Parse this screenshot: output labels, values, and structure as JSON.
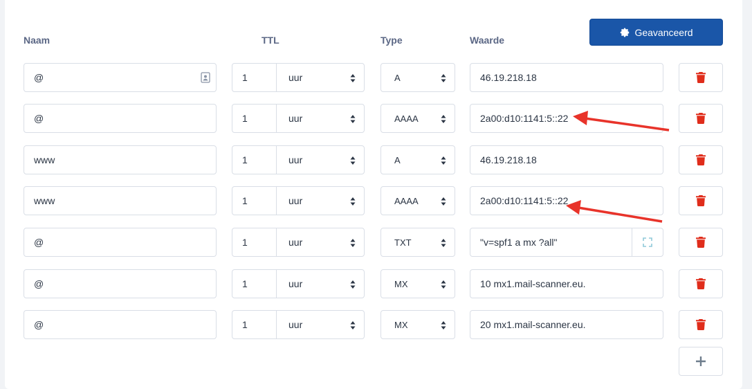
{
  "headers": {
    "name": "Naam",
    "ttl": "TTL",
    "type": "Type",
    "value": "Waarde"
  },
  "advanced_button": {
    "label": "Geavanceerd",
    "icon": "gear-icon",
    "color": "#1a56a8"
  },
  "records": [
    {
      "name": "@",
      "ttl": "1",
      "unit": "uur",
      "type": "A",
      "value": "46.19.218.18"
    },
    {
      "name": "@",
      "ttl": "1",
      "unit": "uur",
      "type": "AAAA",
      "value": "2a00:d10:1141:5::22"
    },
    {
      "name": "www",
      "ttl": "1",
      "unit": "uur",
      "type": "A",
      "value": "46.19.218.18"
    },
    {
      "name": "www",
      "ttl": "1",
      "unit": "uur",
      "type": "AAAA",
      "value": "2a00:d10:1141:5::22"
    },
    {
      "name": "@",
      "ttl": "1",
      "unit": "uur",
      "type": "TXT",
      "value": "\"v=spf1 a mx ?all\""
    },
    {
      "name": "@",
      "ttl": "1",
      "unit": "uur",
      "type": "MX",
      "value": "10 mx1.mail-scanner.eu."
    },
    {
      "name": "@",
      "ttl": "1",
      "unit": "uur",
      "type": "MX",
      "value": "20 mx1.mail-scanner.eu."
    }
  ],
  "icons": {
    "delete": "trash-icon",
    "add": "plus-icon",
    "expand": "expand-icon",
    "contact": "contact-card-icon"
  },
  "colors": {
    "delete": "#e02d1b",
    "annotation_arrow": "#e8332a",
    "header_text": "#5b6785"
  }
}
